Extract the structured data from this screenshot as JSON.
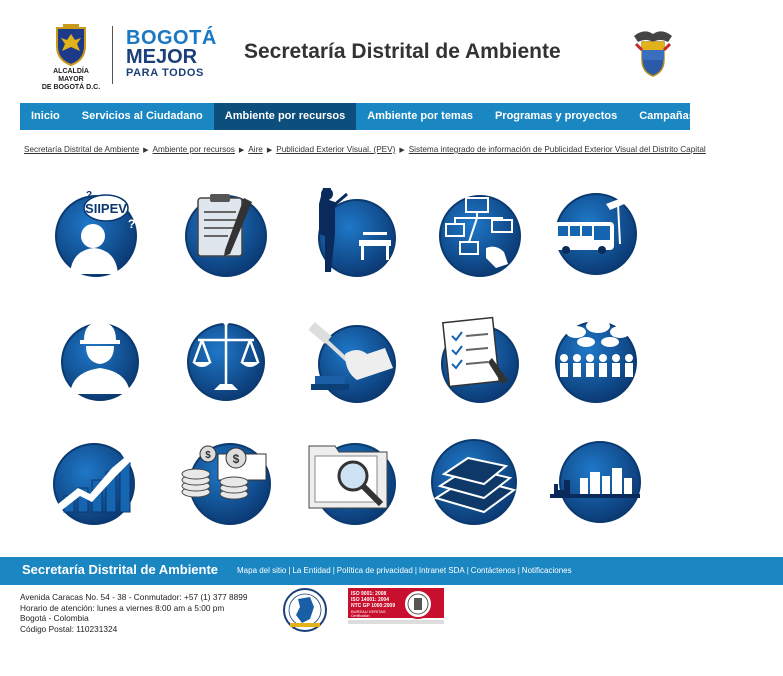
{
  "header": {
    "alcaldia_line1": "ALCALDÍA MAYOR",
    "alcaldia_line2": "DE BOGOTÁ D.C.",
    "logo_line1": "BOGOTÁ",
    "logo_line2": "MEJOR",
    "logo_line3": "PARA TODOS",
    "site_title": "Secretaría Distrital de Ambiente"
  },
  "nav": {
    "items": [
      {
        "label": "Inicio"
      },
      {
        "label": "Servicios al Ciudadano"
      },
      {
        "label": "Ambiente por recursos"
      },
      {
        "label": "Ambiente por temas"
      },
      {
        "label": "Programas y proyectos"
      },
      {
        "label": "Campañas y Eventos"
      }
    ],
    "active_index": 2
  },
  "breadcrumb": {
    "items": [
      "Secretaría Distrital de Ambiente",
      "Ambiente por recursos",
      "Aire",
      "Publicidad Exterior Visual. (PEV)",
      "Sistema integrado de información de Publicidad Exterior Visual del Distrito Capital"
    ]
  },
  "tiles": {
    "siipev_label": "SIIPEV",
    "icons": [
      "siipev-user-icon",
      "clipboard-document-icon",
      "billboard-installer-icon",
      "network-diagram-icon",
      "bus-advertising-icon",
      "worker-helmet-icon",
      "justice-scale-icon",
      "gavel-hand-icon",
      "checklist-form-icon",
      "citizens-group-icon",
      "growth-chart-icon",
      "money-coins-icon",
      "folder-search-icon",
      "books-stack-icon",
      "city-skyline-icon"
    ]
  },
  "footer": {
    "title": "Secretaría Distrital de Ambiente",
    "links": [
      "Mapa del sitio",
      "La Entidad",
      "Política de privacidad",
      "Intranet SDA",
      "Contáctenos",
      "Notificaciones"
    ],
    "address_lines": [
      "Avenida Caracas No. 54 - 38 - Conmutador: +57 (1) 377 8899",
      "Horario de atención: lunes a viernes 8:00 am a 5:00 pm",
      "Bogotá - Colombia",
      "Código Postal: 110231324"
    ],
    "cert_text_1": "ISO 9001: 2008",
    "cert_text_2": "ISO 14001: 2004",
    "cert_text_3": "NTC GP 1000:2009",
    "cert_text_4": "BUREAU VERITAS",
    "cert_text_5": "Certification"
  },
  "colors": {
    "nav_bg": "#1a86c2",
    "nav_active": "#0d4f7c",
    "icon_dark": "#0b3f78",
    "icon_mid": "#1565b0"
  }
}
